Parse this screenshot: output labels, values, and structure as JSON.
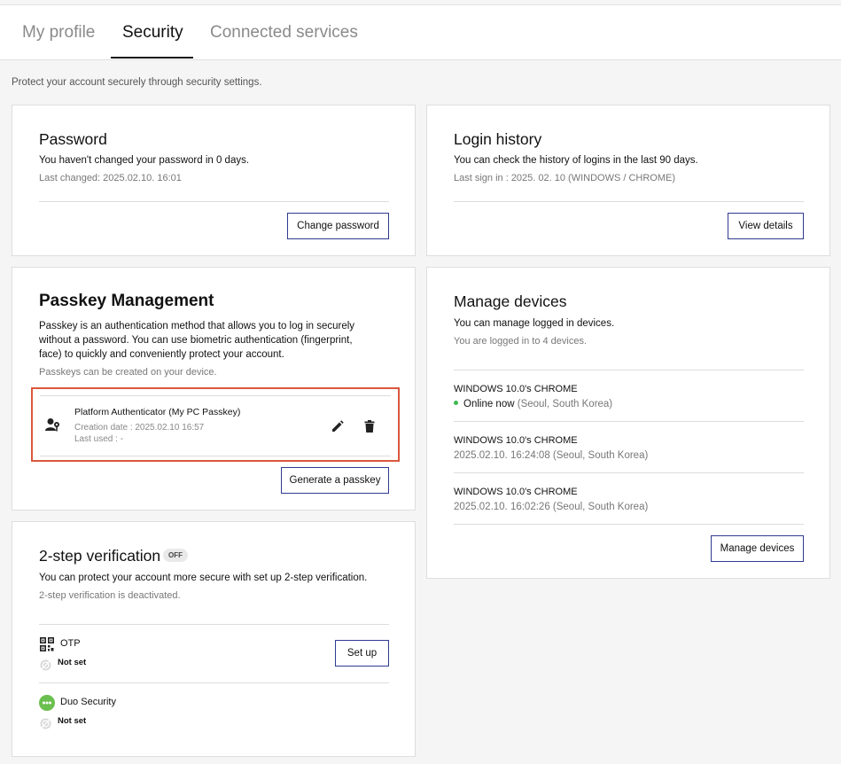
{
  "tabs": [
    {
      "label": "My profile",
      "active": false
    },
    {
      "label": "Security",
      "active": true
    },
    {
      "label": "Connected services",
      "active": false
    }
  ],
  "subtitle": "Protect your account securely through security settings.",
  "password": {
    "title": "Password",
    "line1": "You haven't changed your password in 0 days.",
    "line2": "Last changed: 2025.02.10. 16:01",
    "button": "Change password"
  },
  "login_history": {
    "title": "Login history",
    "line1": "You can check the history of logins in the last 90 days.",
    "line2": "Last sign in : 2025. 02. 10 (WINDOWS / CHROME)",
    "button": "View details"
  },
  "passkey": {
    "title": "Passkey Management",
    "desc": "Passkey is an authentication method that allows you to log in securely without a password. You can use biometric authentication (fingerprint, face) to quickly and conveniently protect your account.",
    "note": "Passkeys can be created on your device.",
    "item": {
      "name": "Platform Authenticator (My PC Passkey)",
      "created": "Creation date : 2025.02.10 16:57",
      "last_used": "Last used : -",
      "icon": "user-key-icon"
    },
    "button": "Generate a passkey"
  },
  "devices": {
    "title": "Manage devices",
    "line1": "You can manage logged in devices.",
    "line2": "You are logged in to 4 devices.",
    "items": [
      {
        "name": "WINDOWS 10.0's CHROME",
        "status_strong": "Online now",
        "status_rest": " (Seoul, South Korea)"
      },
      {
        "name": "WINDOWS 10.0's CHROME",
        "status": "2025.02.10. 16:24:08 (Seoul, South Korea)"
      },
      {
        "name": "WINDOWS 10.0's CHROME",
        "status": "2025.02.10. 16:02:26 (Seoul, South Korea)"
      }
    ],
    "button": "Manage devices"
  },
  "two_step": {
    "title": "2-step verification",
    "badge": "OFF",
    "line1": "You can protect your account more secure with set up 2-step verification.",
    "line2": "2-step verification is deactivated.",
    "methods": [
      {
        "name": "OTP",
        "status": "Not set",
        "icon": "qr-code-icon"
      },
      {
        "name": "Duo Security",
        "status": "Not set",
        "icon": "duo-icon"
      }
    ],
    "setup_button": "Set up"
  },
  "colors": {
    "accent_border": "#2f3a8f",
    "highlight": "#d9573d",
    "online": "#3cba54"
  }
}
